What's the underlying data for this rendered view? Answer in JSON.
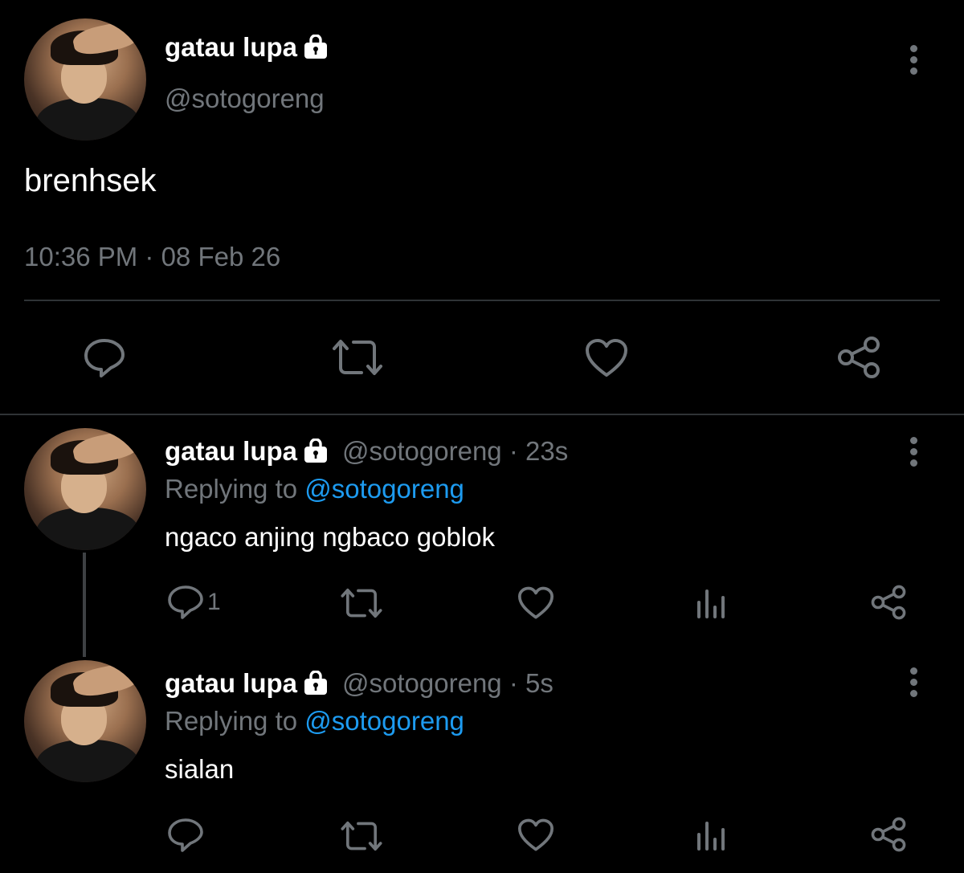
{
  "main_tweet": {
    "name": "gatau lupa",
    "handle": "@sotogoreng",
    "text": "brenhsek",
    "timestamp": "10:36 PM · 08 Feb 26",
    "actions": [
      "reply-icon",
      "retweet-icon",
      "like-icon",
      "share-icon"
    ]
  },
  "replies": [
    {
      "name": "gatau lupa",
      "handle_time": "@sotogoreng · 23s",
      "replying_prefix": "Replying to",
      "replying_handle": "@sotogoreng",
      "text": "ngaco anjing ngbaco goblok",
      "reply_count": "1"
    },
    {
      "name": "gatau lupa",
      "handle_time": "@sotogoreng · 5s",
      "replying_prefix": "Replying to",
      "replying_handle": "@sotogoreng",
      "text": "sialan",
      "reply_count": ""
    }
  ],
  "colors": {
    "background": "#000000",
    "muted": "#71767b",
    "accent": "#1d9bf0",
    "divider": "#2f3336"
  }
}
